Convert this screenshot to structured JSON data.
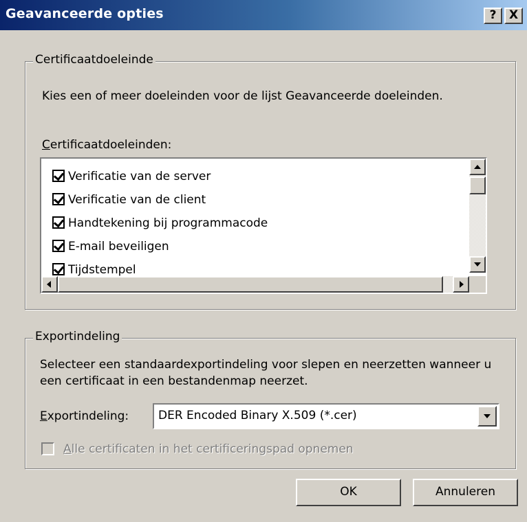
{
  "window": {
    "title": "Geavanceerde opties",
    "help_button": "?",
    "close_button": "X"
  },
  "purpose_group": {
    "legend": "Certificaatdoeleinde",
    "description": "Kies een of meer doeleinden voor de lijst Geavanceerde doeleinden.",
    "list_label_accel": "C",
    "list_label_rest": "ertificaatdoeleinden:",
    "items": [
      {
        "label": "Verificatie van de server",
        "checked": true
      },
      {
        "label": "Verificatie van de client",
        "checked": true
      },
      {
        "label": "Handtekening bij programmacode",
        "checked": true
      },
      {
        "label": "E-mail beveiligen",
        "checked": true
      },
      {
        "label": "Tijdstempel",
        "checked": true
      }
    ]
  },
  "export_group": {
    "legend": "Exportindeling",
    "description": "Selecteer een standaardexportindeling voor slepen en neerzetten wanneer u een certificaat in een bestandenmap neerzet.",
    "format_label_accel": "E",
    "format_label_rest": "xportindeling:",
    "format_value": "DER Encoded Binary X.509 (*.cer)",
    "include_path_accel": "A",
    "include_path_rest": "lle certificaten in het certificeringspad opnemen",
    "include_path_checked": false,
    "include_path_enabled": false
  },
  "buttons": {
    "ok": "OK",
    "cancel": "Annuleren"
  }
}
